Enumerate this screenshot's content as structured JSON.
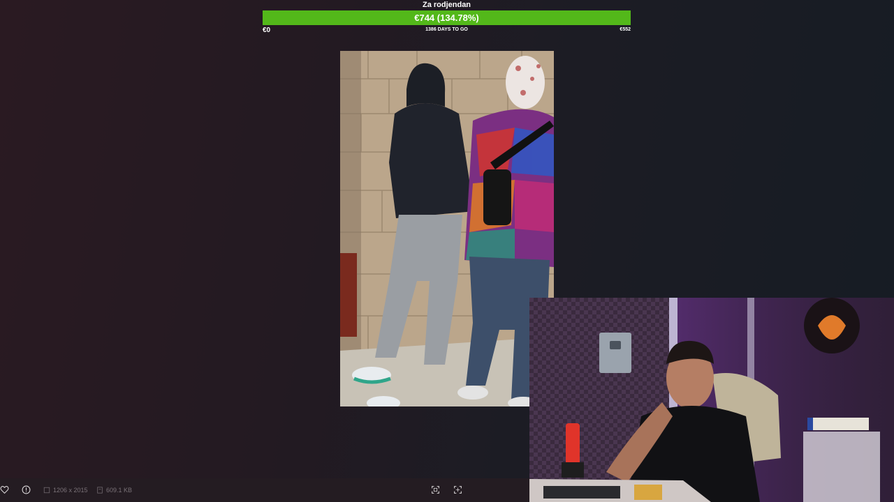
{
  "goal": {
    "title": "Za rodjendan",
    "amount_text": "€744 (134.78%)",
    "progress_percent": 100,
    "min_label": "€0",
    "days_label": "1386 DAYS TO GO",
    "max_label": "€552",
    "bar_color": "#53b81a"
  },
  "viewer": {
    "dimensions": "1206 x 2015",
    "file_size": "609.1 KB"
  },
  "icons": {
    "favorite": "heart-icon",
    "info": "info-icon",
    "dimensions": "image-size-icon",
    "file": "file-size-icon",
    "fit": "fit-screen-icon",
    "fullscreen": "fullscreen-icon"
  }
}
